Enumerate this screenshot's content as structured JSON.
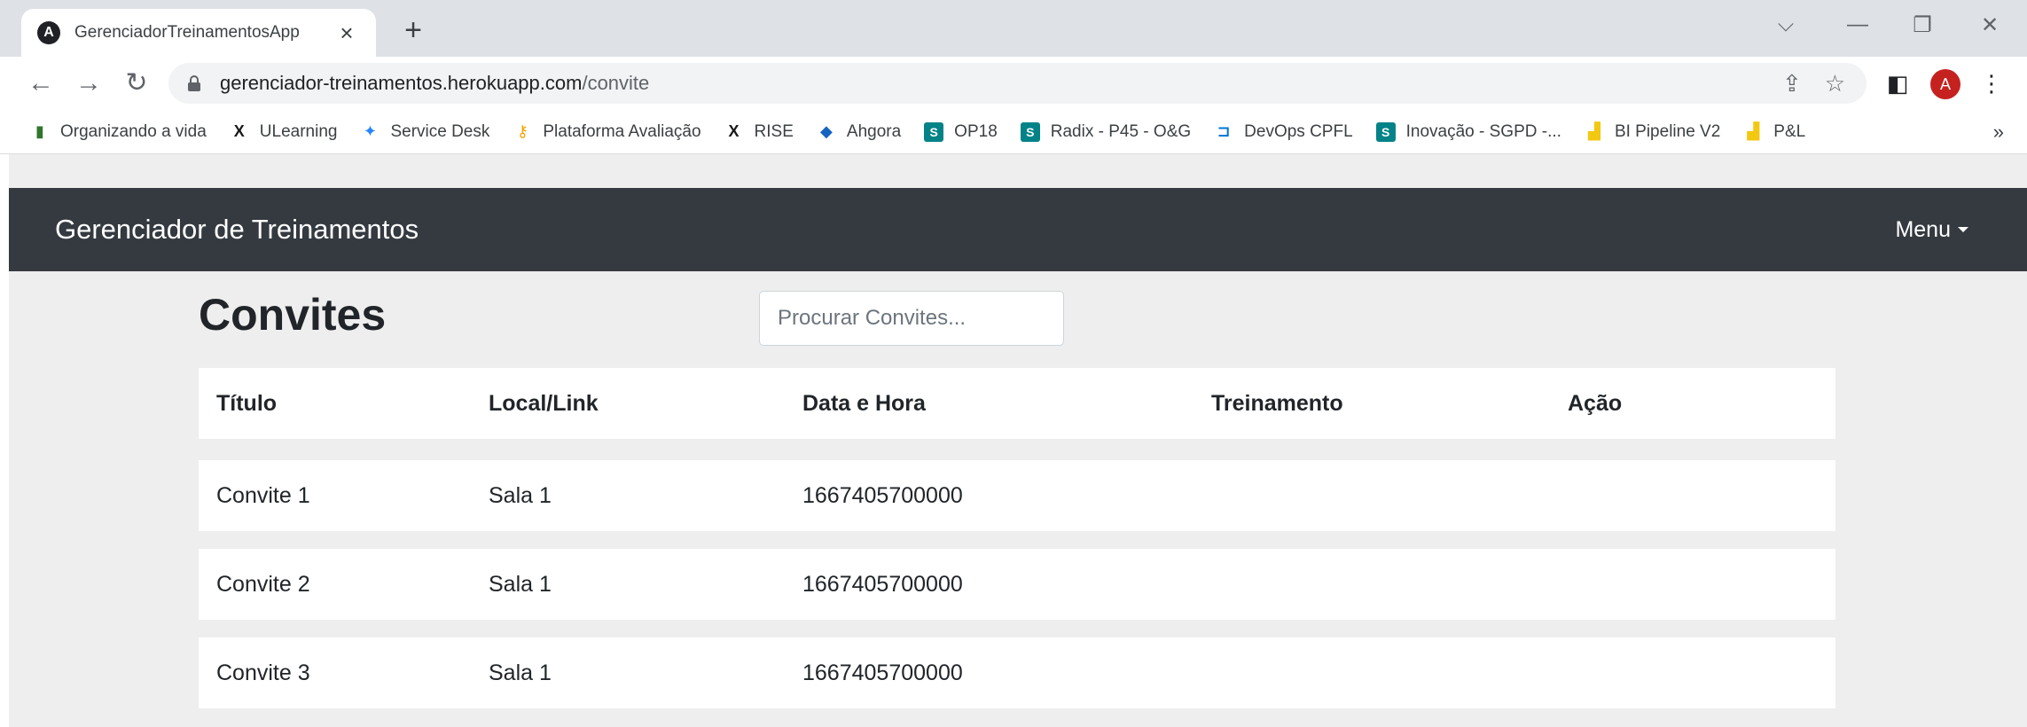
{
  "browser": {
    "tab_title": "GerenciadorTreinamentosApp",
    "tab_favicon_letter": "A",
    "url_host": "gerenciador-treinamentos.herokuapp.com",
    "url_path": "/convite",
    "profile_initial": "A",
    "bookmarks": [
      {
        "label": "Organizando a vida",
        "icon": "planner-icon",
        "color": "#31752f",
        "glyph": "▮"
      },
      {
        "label": "ULearning",
        "icon": "x-logo-icon",
        "color": "#1a1a1a",
        "glyph": "X"
      },
      {
        "label": "Service Desk",
        "icon": "jira-icon",
        "color": "#2684ff",
        "glyph": "✦"
      },
      {
        "label": "Plataforma Avaliação",
        "icon": "key-icon",
        "color": "#f4a300",
        "glyph": "⚷"
      },
      {
        "label": "RISE",
        "icon": "x-logo-icon",
        "color": "#1a1a1a",
        "glyph": "X"
      },
      {
        "label": "Ahgora",
        "icon": "ahgora-icon",
        "color": "#1565c0",
        "glyph": "◆"
      },
      {
        "label": "OP18",
        "icon": "sharepoint-icon",
        "color": "#038387",
        "glyph": "S"
      },
      {
        "label": "Radix - P45 - O&G",
        "icon": "sharepoint-icon",
        "color": "#038387",
        "glyph": "S"
      },
      {
        "label": "DevOps CPFL",
        "icon": "azure-devops-icon",
        "color": "#0078d4",
        "glyph": "⊐"
      },
      {
        "label": "Inovação - SGPD -...",
        "icon": "sharepoint-icon",
        "color": "#038387",
        "glyph": "S"
      },
      {
        "label": "BI Pipeline V2",
        "icon": "power-bi-icon",
        "color": "#f2c811",
        "glyph": "▟"
      },
      {
        "label": "P&L",
        "icon": "power-bi-icon",
        "color": "#f2c811",
        "glyph": "▟"
      }
    ]
  },
  "navbar": {
    "brand": "Gerenciador de Treinamentos",
    "menu_label": "Menu"
  },
  "page": {
    "title": "Convites",
    "search_placeholder": "Procurar Convites..."
  },
  "table": {
    "columns": [
      "Título",
      "Local/Link",
      "Data e Hora",
      "Treinamento",
      "Ação"
    ],
    "rows": [
      [
        "Convite 1",
        "Sala 1",
        "1667405700000",
        "",
        ""
      ],
      [
        "Convite 2",
        "Sala 1",
        "1667405700000",
        "",
        ""
      ],
      [
        "Convite 3",
        "Sala 1",
        "1667405700000",
        "",
        ""
      ]
    ]
  }
}
